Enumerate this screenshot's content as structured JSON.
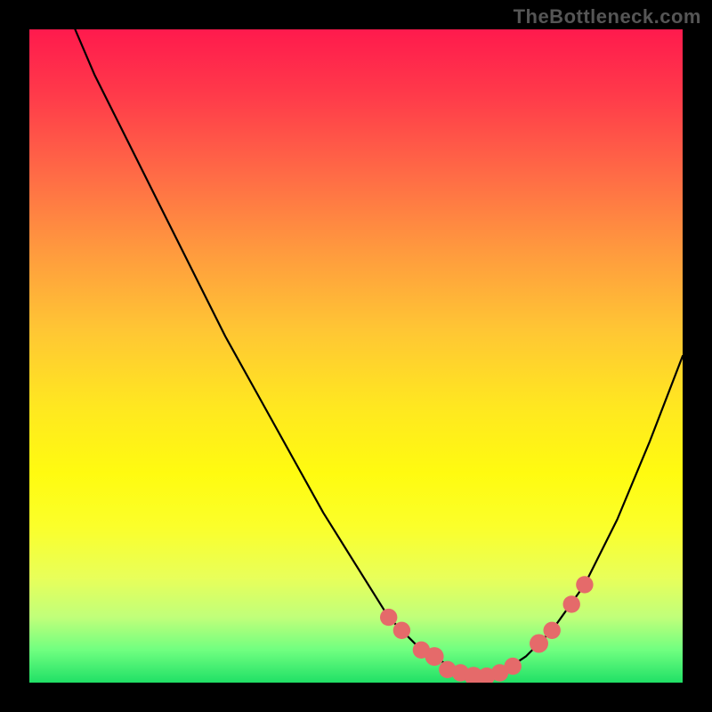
{
  "watermark": "TheBottleneck.com",
  "chart_data": {
    "type": "line",
    "title": "",
    "xlabel": "",
    "ylabel": "",
    "xlim": [
      0,
      100
    ],
    "ylim": [
      0,
      100
    ],
    "background_gradient": {
      "top": "#ff1a4d",
      "bottom": "#20e066",
      "description": "red-to-green vertical gradient indicating bottleneck severity"
    },
    "series": [
      {
        "name": "bottleneck-curve",
        "color": "#000000",
        "x": [
          7,
          10,
          15,
          20,
          25,
          30,
          35,
          40,
          45,
          50,
          55,
          57,
          60,
          62,
          65,
          68,
          70,
          73,
          76,
          80,
          85,
          90,
          95,
          100
        ],
        "y": [
          100,
          93,
          83,
          73,
          63,
          53,
          44,
          35,
          26,
          18,
          10,
          8,
          5,
          4,
          2,
          1,
          1,
          2,
          4,
          8,
          15,
          25,
          37,
          50
        ]
      }
    ],
    "markers": [
      {
        "x": 55,
        "y": 10,
        "r": 1.2
      },
      {
        "x": 57,
        "y": 8,
        "r": 1.2
      },
      {
        "x": 60,
        "y": 5,
        "r": 1.2
      },
      {
        "x": 62,
        "y": 4,
        "r": 1.3
      },
      {
        "x": 64,
        "y": 2,
        "r": 1.2
      },
      {
        "x": 66,
        "y": 1.5,
        "r": 1.2
      },
      {
        "x": 68,
        "y": 1,
        "r": 1.3
      },
      {
        "x": 70,
        "y": 1,
        "r": 1.2
      },
      {
        "x": 72,
        "y": 1.5,
        "r": 1.2
      },
      {
        "x": 74,
        "y": 2.5,
        "r": 1.2
      },
      {
        "x": 78,
        "y": 6,
        "r": 1.3
      },
      {
        "x": 80,
        "y": 8,
        "r": 1.2
      },
      {
        "x": 83,
        "y": 12,
        "r": 1.2
      },
      {
        "x": 85,
        "y": 15,
        "r": 1.2
      }
    ],
    "colors": {
      "curve": "#000000",
      "markers": "#e56a6a",
      "frame": "#000000"
    }
  }
}
